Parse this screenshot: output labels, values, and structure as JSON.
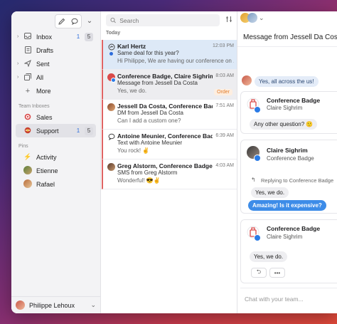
{
  "sidebar": {
    "toolbar": {
      "compose_icon": "pencil-icon",
      "chat_icon": "chat-bubble-icon",
      "menu_icon": "chevron-down-icon"
    },
    "items": [
      {
        "label": "Inbox",
        "icon": "inbox-icon",
        "count_unread": "1",
        "count_total": "5"
      },
      {
        "label": "Drafts",
        "icon": "draft-icon"
      },
      {
        "label": "Sent",
        "icon": "sent-icon"
      },
      {
        "label": "All",
        "icon": "all-icon"
      },
      {
        "label": "More",
        "icon": "plus-icon"
      }
    ],
    "team_section_label": "Team Inboxes",
    "team_inboxes": [
      {
        "label": "Sales",
        "icon": "target-icon"
      },
      {
        "label": "Support",
        "icon": "support-icon",
        "count_unread": "1",
        "count_total": "5"
      }
    ],
    "pins_section_label": "Pins",
    "pins": [
      {
        "label": "Activity",
        "icon": "lightning-icon"
      },
      {
        "label": "Etienne"
      },
      {
        "label": "Rafael"
      }
    ],
    "footer": {
      "user_name": "Philippe Lehoux"
    }
  },
  "list": {
    "search_placeholder": "Search",
    "day_label": "Today",
    "conversations": [
      {
        "name": "Karl Hertz",
        "time": "12:03 PM",
        "line1": "Same deal for this year?",
        "line2": "Hi Philippe, We are having our conference on ..."
      },
      {
        "name": "Conference Badge, Claire Sighrim",
        "time": "8:03 AM",
        "line1": "Message from Jessell Da Costa",
        "line2": "Yes, we do.",
        "tag": "Order"
      },
      {
        "name": "Jessell Da Costa, Conference Badge",
        "time": "7:51 AM",
        "line1": "DM from Jessell Da Costa",
        "line2": "Can I add a custom one?"
      },
      {
        "name": "Antoine Meunier, Conference Badge",
        "time": "6:39 AM",
        "line1": "Text with Antoine Meunier",
        "line2": "You rock! ✌"
      },
      {
        "name": "Greg Alstorm, Conference Badge",
        "time": "4:03 AM",
        "line1": "SMS from Greg Alstorm",
        "line2": "Wonderful! 😎✌"
      }
    ]
  },
  "conversation": {
    "title": "Message from Jessell Da Costa",
    "first_reply": "Yes, all across the us!",
    "card1": {
      "from": "Conference Badge",
      "sub": "Claire Sighrim",
      "bubble": "Any other question? 🙂"
    },
    "card2": {
      "from": "Claire Sighrim",
      "sub": "Conference Badge",
      "reply_label": "Replying to Conference Badge",
      "reply_quote": "Yes, we do.",
      "bubble": "Amazing! Is it expensive?"
    },
    "card3": {
      "from": "Conference Badge",
      "sub": "Claire Sighrim",
      "bubble": "Yes, we do."
    },
    "reply_icon": "reply-icon",
    "more_icon": "ellipsis-icon",
    "composer_placeholder": "Chat with your team..."
  },
  "colors": {
    "accent": "#2d6ddc",
    "unread_bar": "#e06464",
    "selected_row": "#dde9f7",
    "bubble_blue": "#3d8ce8",
    "order_tag": "#e27c2b"
  }
}
